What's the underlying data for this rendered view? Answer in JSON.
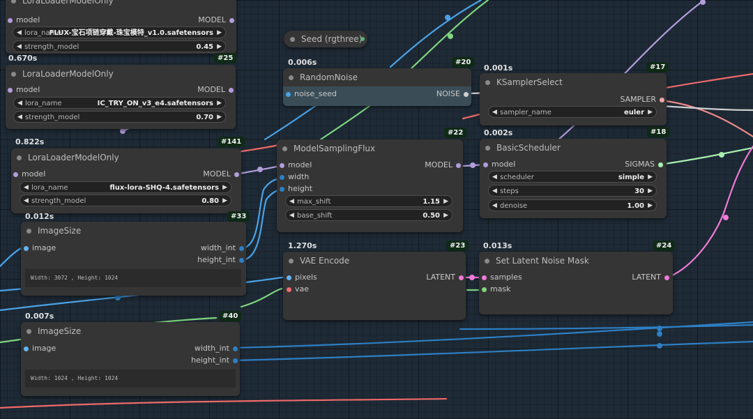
{
  "colors": {
    "background": "#1e2a36",
    "node_body": "#353535",
    "badge_bg": "#0f2a16",
    "model_wire": "#b39ddb",
    "int_wire": "#4aa3e8",
    "float_wire": "#7fd67f",
    "vae_wire": "#ef6a6a",
    "latent_wire": "#f07ad8",
    "sigmas_wire": "#a8f0b0",
    "noise_wire": "#cfcfcf"
  },
  "nodes": {
    "lora_top": {
      "title": "LoraLoaderModelOnly",
      "input_model": "model",
      "output_model": "MODEL",
      "lora_name_label": "lora_name",
      "lora_name_value": "FLUX-宝石项链穿戴-珠宝模特_v1.0.safetensors",
      "strength_label": "strength_model",
      "strength_value": "0.45"
    },
    "lora_25": {
      "timing": "0.670s",
      "badge": "#25",
      "title": "LoraLoaderModelOnly",
      "input_model": "model",
      "output_model": "MODEL",
      "lora_name_label": "lora_name",
      "lora_name_value": "IC_TRY_ON_v3_e4.safetensors",
      "strength_label": "strength_model",
      "strength_value": "0.70"
    },
    "lora_141": {
      "timing": "0.822s",
      "badge": "#141",
      "title": "LoraLoaderModelOnly",
      "input_model": "model",
      "output_model": "MODEL",
      "lora_name_label": "lora_name",
      "lora_name_value": "flux-lora-SHQ-4.safetensors",
      "strength_label": "strength_model",
      "strength_value": "0.80"
    },
    "imagesize_33": {
      "timing": "0.012s",
      "badge": "#33",
      "title": "ImageSize",
      "input_image": "image",
      "output_width": "width_int",
      "output_height": "height_int",
      "preview": "Width: 3072 , Height: 1024"
    },
    "imagesize_40": {
      "timing": "0.007s",
      "badge": "#40",
      "title": "ImageSize",
      "input_image": "image",
      "output_width": "width_int",
      "output_height": "height_int",
      "preview": "Width: 1024 , Height: 1024"
    },
    "seed": {
      "title": "Seed (rgthree)"
    },
    "randomnoise_20": {
      "timing": "0.006s",
      "badge": "#20",
      "title": "RandomNoise",
      "input_seed": "noise_seed",
      "output_noise": "NOISE"
    },
    "modelsampling_22": {
      "badge": "#22",
      "title": "ModelSamplingFlux",
      "input_model": "model",
      "input_width": "width",
      "input_height": "height",
      "output_model": "MODEL",
      "max_shift_label": "max_shift",
      "max_shift_value": "1.15",
      "base_shift_label": "base_shift",
      "base_shift_value": "0.50"
    },
    "vaeencode_23": {
      "timing": "1.270s",
      "badge": "#23",
      "title": "VAE Encode",
      "input_pixels": "pixels",
      "input_vae": "vae",
      "output_latent": "LATENT"
    },
    "ksamplerselect_17": {
      "timing": "0.001s",
      "badge": "#17",
      "title": "KSamplerSelect",
      "output_sampler": "SAMPLER",
      "sampler_label": "sampler_name",
      "sampler_value": "euler"
    },
    "basicscheduler_18": {
      "timing": "0.002s",
      "badge": "#18",
      "title": "BasicScheduler",
      "input_model": "model",
      "output_sigmas": "SIGMAS",
      "scheduler_label": "scheduler",
      "scheduler_value": "simple",
      "steps_label": "steps",
      "steps_value": "30",
      "denoise_label": "denoise",
      "denoise_value": "1.00"
    },
    "setlatentmask_24": {
      "timing": "0.013s",
      "badge": "#24",
      "title": "Set Latent Noise Mask",
      "input_samples": "samples",
      "input_mask": "mask",
      "output_latent": "LATENT"
    }
  }
}
